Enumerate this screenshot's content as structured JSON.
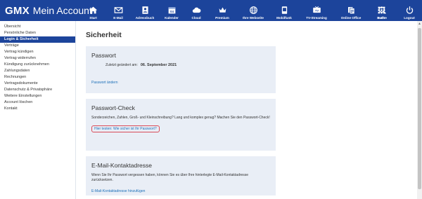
{
  "header": {
    "brand_logo": "GMX",
    "brand_title": "Mein Account",
    "nav": [
      {
        "label": "Start",
        "icon": "home-icon"
      },
      {
        "label": "E-Mail",
        "icon": "mail-icon"
      },
      {
        "label": "Adressbuch",
        "icon": "address-book-icon"
      },
      {
        "label": "Kalender",
        "icon": "calendar-icon"
      },
      {
        "label": "Cloud",
        "icon": "cloud-icon"
      },
      {
        "label": "Premium",
        "icon": "crown-icon"
      },
      {
        "label": "Ihre Webseite",
        "icon": "globe-icon"
      },
      {
        "label": "Mobilfunk",
        "icon": "mobile-icon"
      },
      {
        "label": "TV-Streaming",
        "icon": "tv-icon"
      },
      {
        "label": "Online Office",
        "icon": "office-icon"
      },
      {
        "label": "mehr",
        "icon": "grid-icon"
      }
    ],
    "right": [
      {
        "label": "Suche",
        "icon": "search-icon"
      },
      {
        "label": "Logout",
        "icon": "power-icon"
      }
    ]
  },
  "sidebar": {
    "items": [
      {
        "label": "Übersicht"
      },
      {
        "label": "Persönliche Daten"
      },
      {
        "label": "Login & Sicherheit",
        "active": true
      },
      {
        "label": "Verträge"
      },
      {
        "label": "Vertrag kündigen"
      },
      {
        "label": "Vertrag widerrufen"
      },
      {
        "label": "Kündigung zurücknehmen"
      },
      {
        "label": "Zahlungsdaten"
      },
      {
        "label": "Rechnungen"
      },
      {
        "label": "Vertragsdokumente"
      },
      {
        "label": "Datenschutz & Privatsphäre"
      },
      {
        "label": "Weitere Einstellungen"
      },
      {
        "label": "Account löschen"
      },
      {
        "label": "Kontakt"
      }
    ]
  },
  "main": {
    "title": "Sicherheit",
    "password": {
      "heading": "Passwort",
      "changed_label": "Zuletzt geändert am:",
      "changed_date": "06. September 2021",
      "link": "Passwort ändern"
    },
    "check": {
      "heading": "Passwort-Check",
      "text": "Sonderzeichen, Zahlen, Groß- und Kleinschreibung? Lang und komplex genug? Machen Sie den Passwort-Check!",
      "link": "Hier testen: Wie sicher ist Ihr Passwort?"
    },
    "email": {
      "heading": "E-Mail-Kontaktadresse",
      "text": "Wenn Sie Ihr Passwort vergessen haben, können Sie es über Ihre hinterlegte E-Mail-Kontaktadresse zurücksetzen.",
      "link": "E-Mail-Kontaktadresse hinzufügen"
    }
  },
  "colors": {
    "brand": "#1c449b",
    "card_bg": "#e9eef6",
    "link": "#1c6fb8",
    "highlight": "#d94a57"
  }
}
